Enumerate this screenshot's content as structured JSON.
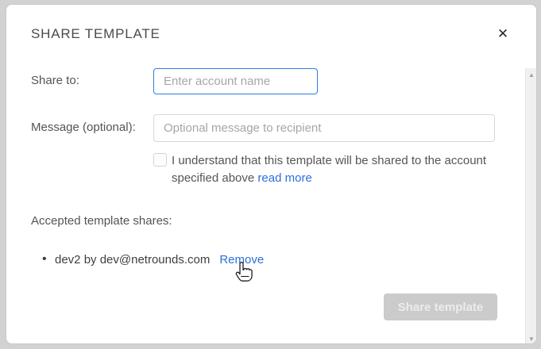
{
  "dialog": {
    "title": "SHARE TEMPLATE",
    "close_icon": "✕"
  },
  "form": {
    "share_to_label": "Share to:",
    "share_to_placeholder": "Enter account name",
    "message_label": "Message (optional):",
    "message_placeholder": "Optional message to recipient",
    "consent_text": "I understand that this template will be shared to the account specified above",
    "read_more_label": "read more",
    "checkbox_checked": false
  },
  "shares": {
    "heading": "Accepted template shares:",
    "items": [
      {
        "text": "dev2 by dev@netrounds.com",
        "action_label": "Remove"
      }
    ]
  },
  "footer": {
    "share_button_label": "Share template",
    "share_button_enabled": false
  },
  "scrollbar": {
    "up_icon": "▲",
    "down_icon": "▼"
  },
  "colors": {
    "accent_blue": "#2e7ce4",
    "link_blue": "#2e6fd9",
    "disabled_button_bg": "#cbcbcb",
    "backdrop": "#d2d2d2"
  }
}
